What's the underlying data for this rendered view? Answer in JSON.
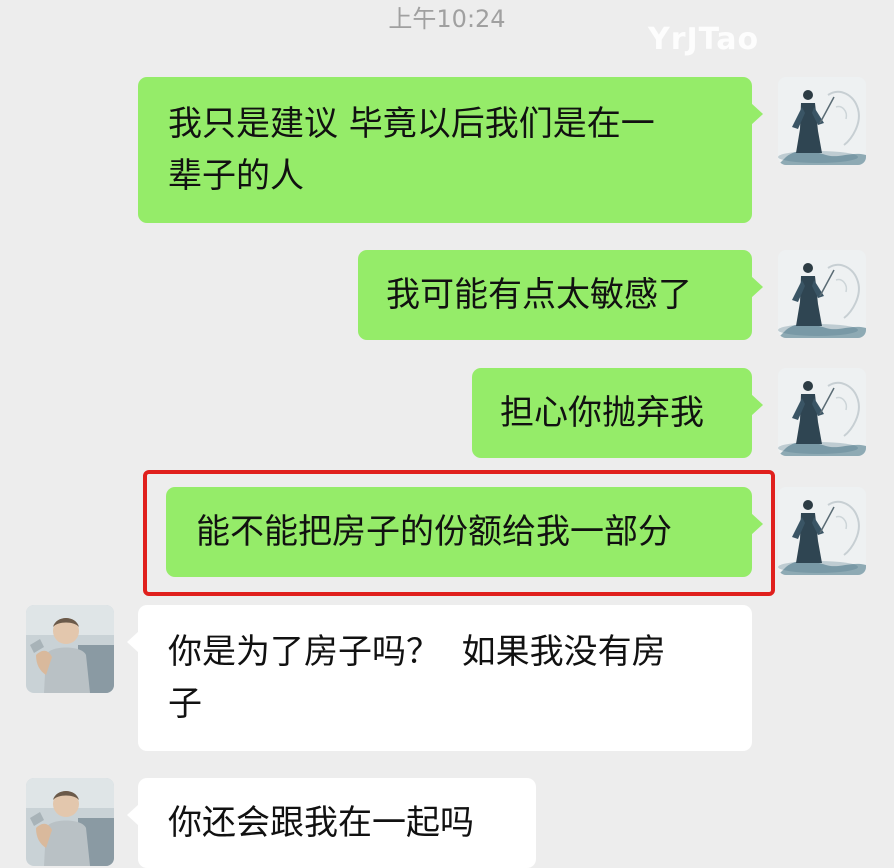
{
  "header": {
    "timestamp": "上午10:24",
    "watermark": "YrJTao"
  },
  "messages": [
    {
      "sender": "me",
      "line1": "我只是建议 毕竟以后我们是在一",
      "line2": "辈子的人"
    },
    {
      "sender": "me",
      "text": "我可能有点太敏感了"
    },
    {
      "sender": "me",
      "text": "担心你抛弃我"
    },
    {
      "sender": "me",
      "text": "能不能把房子的份额给我一部分",
      "highlighted": true
    },
    {
      "sender": "them",
      "line1": "你是为了房子吗？  如果我没有房",
      "line2": "子"
    },
    {
      "sender": "them",
      "text": "你还会跟我在一起吗"
    }
  ],
  "colors": {
    "background": "#ededed",
    "my_bubble": "#95ec69",
    "their_bubble": "#ffffff",
    "highlight_border": "#e0201d"
  },
  "icons": {
    "my_avatar": "ink-painting-swordsman-avatar",
    "their_avatar": "child-photo-avatar"
  }
}
